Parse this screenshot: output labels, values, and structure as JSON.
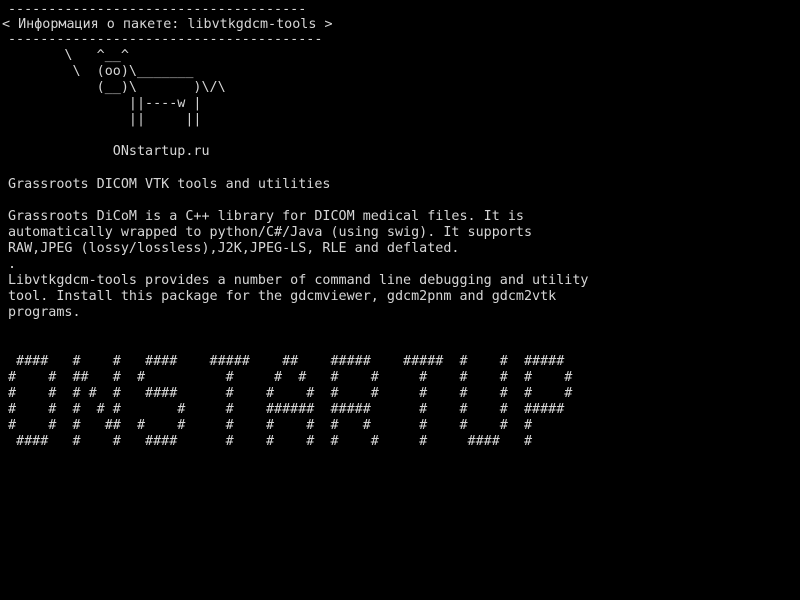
{
  "screen": {
    "background_color": "#000000",
    "text_color": "#d6d6d6"
  },
  "banner": {
    "top_border": "-------------------------------------",
    "title": "< Информация о пакете: libvtkgdcm-tools >",
    "bottom_border": "---------------------------------------"
  },
  "cowsay": {
    "lines": [
      "       \\   ^__^",
      "        \\  (oo)\\_______",
      "           (__)\\       )\\/\\",
      "               ||----w |",
      "               ||     ||"
    ]
  },
  "site_credit": "             ONstartup.ru",
  "package": {
    "summary": "Grassroots DICOM VTK tools and utilities",
    "description": [
      "Grassroots DiCoM is a C++ library for DICOM medical files. It is",
      "automatically wrapped to python/C#/Java (using swig). It supports",
      "RAW,JPEG (lossy/lossless),J2K,JPEG-LS, RLE and deflated.",
      ".",
      "Libvtkgdcm-tools provides a number of command line debugging and utility",
      "tool. Install this package for the gdcmviewer, gdcm2pnm and gdcm2vtk",
      "programs."
    ]
  },
  "ascii_art_banner": {
    "lines": [
      " ####   #    #   ####    #####    ##    #####    #####  #    #  #####",
      "#    #  ##   #  #          #     #  #   #    #     #    #    #  #    #",
      "#    #  # #  #   ####      #    #    #  #    #     #    #    #  #    #",
      "#    #  #  # #       #     #    ######  #####      #    #    #  #####",
      "#    #  #   ##  #    #     #    #    #  #   #      #    #    #  #",
      " ####   #    #   ####      #    #    #  #    #     #     ####   #"
    ]
  }
}
